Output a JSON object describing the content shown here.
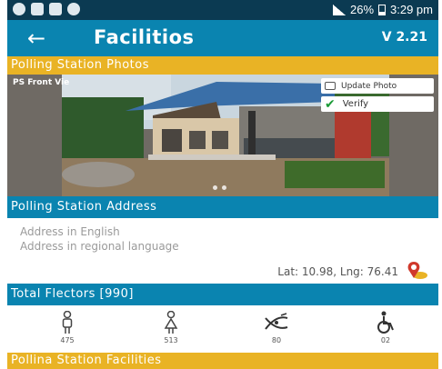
{
  "status_bar": {
    "battery": "26%",
    "time": "3:29 pm"
  },
  "app_bar": {
    "back_icon": "arrow-left-icon",
    "title": "Facilitios",
    "version": "V 2.21"
  },
  "photos_section": {
    "title": "Polling Station Photos",
    "photo_label": "PS Front Vie",
    "update_button": "Update Photo",
    "verify_button": "Verify"
  },
  "address_section": {
    "title": "Polling Station Address",
    "english": "Address in English",
    "regional": "Address in regional language",
    "latlng": "Lat: 10.98, Lng: 76.41"
  },
  "electors": {
    "title": "Total Flectors [990]",
    "stats": [
      {
        "icon": "male-icon",
        "value": "475"
      },
      {
        "icon": "female-icon",
        "value": "513"
      },
      {
        "icon": "transgender-icon",
        "value": "80"
      },
      {
        "icon": "wheelchair-icon",
        "value": "02"
      }
    ]
  },
  "facilities_section": {
    "title": "Pollina Station Facilities"
  },
  "colors": {
    "status_bar": "#0b3a52",
    "app_bar": "#0a84b0",
    "section_yellow": "#e9b325",
    "section_blue": "#0a84b0"
  }
}
